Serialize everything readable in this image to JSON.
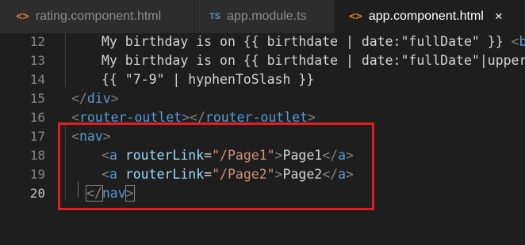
{
  "tabs": [
    {
      "icon": "html-file-icon",
      "glyph": "<>",
      "label": "rating.component.html",
      "active": false
    },
    {
      "icon": "ts-file-icon",
      "glyph": "TS",
      "label": "app.module.ts",
      "active": false
    },
    {
      "icon": "html-file-icon",
      "glyph": "<>",
      "label": "app.component.html",
      "active": true,
      "close": "×"
    }
  ],
  "lines": [
    {
      "num": "12"
    },
    {
      "num": "13"
    },
    {
      "num": "14"
    },
    {
      "num": "15"
    },
    {
      "num": "16"
    },
    {
      "num": "17"
    },
    {
      "num": "18"
    },
    {
      "num": "19"
    },
    {
      "num": "20"
    }
  ],
  "code": {
    "l12": {
      "text": "My birthday is on {{ birthdate | date:\"fullDate\" }} ",
      "tag_open": "<",
      "tag_name": "br",
      "tag_close": "/"
    },
    "l13": {
      "text": "My birthday is on {{ birthdate | date:\"fullDate\"|uppercas"
    },
    "l14": {
      "text": "{{ \"7-9\" | hyphenToSlash }}"
    },
    "l15": {
      "tag_open": "</",
      "tag_name": "div",
      "tag_close": ">"
    },
    "l16": {
      "open1": "<",
      "name1": "router-outlet",
      "close1": "></",
      "name2": "router-outlet",
      "close2": ">"
    },
    "l17": {
      "tag_open": "<",
      "tag_name": "nav",
      "tag_close": ">"
    },
    "l18": {
      "open": "<",
      "name": "a",
      "attr": "routerLink",
      "eq": "=",
      "value": "\"/Page1\"",
      "close": ">",
      "text": "Page1",
      "end_open": "</",
      "end_name": "a",
      "end_close": ">"
    },
    "l19": {
      "open": "<",
      "name": "a",
      "attr": "routerLink",
      "eq": "=",
      "value": "\"/Page2\"",
      "close": ">",
      "text": "Page2",
      "end_open": "</",
      "end_name": "a",
      "end_close": ">"
    },
    "l20": {
      "tag_open": "</",
      "tag_name": "nav",
      "tag_close": ">"
    }
  },
  "colors": {
    "background": "#1e1e1e",
    "tag_bracket": "#808080",
    "tag_name": "#569cd6",
    "attribute": "#9cdcfe",
    "string": "#ce9178",
    "text": "#d4d4d4",
    "highlight_box": "#e02020"
  }
}
